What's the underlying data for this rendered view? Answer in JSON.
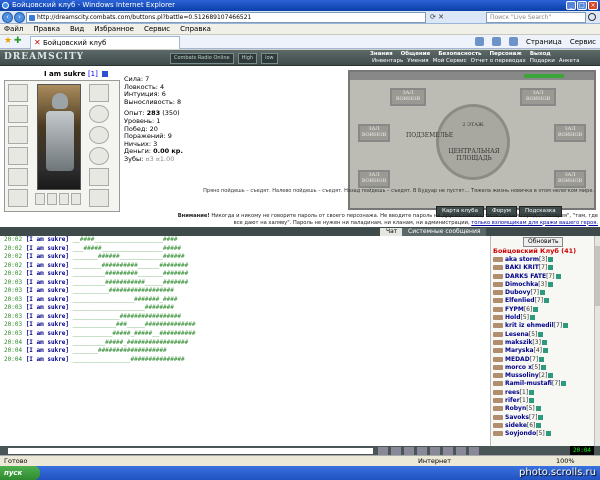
{
  "window": {
    "title": "Бойцовский клуб - Windows Internet Explorer"
  },
  "address": {
    "url": "http://dreamscity.combats.com/buttons.pl?battle=0.512689107466521",
    "search_placeholder": "Поиск \"Live Search\""
  },
  "menu": [
    "Файл",
    "Правка",
    "Вид",
    "Избранное",
    "Сервис",
    "Справка"
  ],
  "tab": {
    "label": "Бойцовский клуб"
  },
  "toolbar": {
    "page_label": "Страница",
    "tools_label": "Сервис"
  },
  "game": {
    "logo": "DREAMSCITY",
    "header_buttons": [
      "Combats Radio Online",
      "High",
      "low"
    ],
    "nav": [
      "Знания",
      "Общение",
      "Безопасность",
      "Персонаж",
      "Выход"
    ],
    "nav2": [
      "Инвентарь",
      "Умения",
      "Мой Сервис",
      "Отчет о переводах",
      "Подарки",
      "Анкета"
    ]
  },
  "player": {
    "name": "I am sukre",
    "level": "[1]"
  },
  "stats": {
    "strength": "Сила: 7",
    "agility": "Ловкость: 4",
    "intuition": "Интуиция: 6",
    "endurance": "Выносливость: 8",
    "exp_label": "Опыт:",
    "exp_value": "283",
    "exp_next": "(350)",
    "level": "Уровень: 1",
    "wins": "Побед: 20",
    "losses": "Поражений: 9",
    "draws": "Ничьих: 3",
    "money_label": "Деньги:",
    "money_value": "0.00 кр.",
    "teeth_label": "Зубы:",
    "teeth_value": "¤3 ¤1.00"
  },
  "map": {
    "floor": "2 ЭТАЖ",
    "center": "ЦЕНТРАЛЬНАЯ ПЛОЩАДЬ",
    "basement": "ПОДЗЕМЕЛЬЕ",
    "rooms": [
      "ЗАЛ ВОИНОВ",
      "ЗАЛ ВОИНОВ",
      "ЗАЛ ВОИНОВ",
      "ЗАЛ ВОИНОВ",
      "ЗАЛ ВОИНОВ",
      "ЗАЛ ВОИНОВ"
    ]
  },
  "quote": "Пряно пойдешь – съедят. Налево пойдешь – съедят. Назад пойдешь – съедят. В Будуар не пустят… Тяжела жизнь новичка в этом нелегком мире.",
  "buttons": {
    "map": "Карта клуба",
    "forum": "Форум",
    "hint": "Подсказка"
  },
  "warning": {
    "prefix": "Внимание!",
    "text": "Никогда и никому не говорите пароль от своего персонажа. Не вводите пароль на других сайтах, типа \"новый город\", \"лотерея\", \"там, где все дают на халяву\". Пароль не нужен ни паладинам, ни кланам, ни администрации,",
    "link": "только взломщикам для кражи вашего героя."
  },
  "chat_tabs": [
    "Чат",
    "Системные сообщения"
  ],
  "chat": [
    {
      "time": "20:02",
      "name": "[I am sukre]",
      "msg": "__####___________________####"
    },
    {
      "time": "20:02",
      "name": "[I am sukre]",
      "msg": "___#####_________________#####"
    },
    {
      "time": "20:02",
      "name": "[I am sukre]",
      "msg": "_______######____________######"
    },
    {
      "time": "20:02",
      "name": "[I am sukre]",
      "msg": "________##########______########"
    },
    {
      "time": "20:02",
      "name": "[I am sukre]",
      "msg": "_________#########_______#######"
    },
    {
      "time": "20:03",
      "name": "[I am sukre]",
      "msg": "_________###########_____#######"
    },
    {
      "time": "20:03",
      "name": "[I am sukre]",
      "msg": "__________##################"
    },
    {
      "time": "20:03",
      "name": "[I am sukre]",
      "msg": "_________________#######_####"
    },
    {
      "time": "20:03",
      "name": "[I am sukre]",
      "msg": "____________________########"
    },
    {
      "time": "20:03",
      "name": "[I am sukre]",
      "msg": "_____________#################"
    },
    {
      "time": "20:03",
      "name": "[I am sukre]",
      "msg": "____________###_____##############"
    },
    {
      "time": "20:03",
      "name": "[I am sukre]",
      "msg": "___________#####_#####__##########"
    },
    {
      "time": "20:04",
      "name": "[I am sukre]",
      "msg": "_________#####_#################"
    },
    {
      "time": "20:04",
      "name": "[I am sukre]",
      "msg": "_______###################"
    },
    {
      "time": "20:04",
      "name": "[I am sukre]",
      "msg": "________________###############"
    }
  ],
  "room": {
    "refresh": "Обновить",
    "title": "Бойцовский Клуб (41)"
  },
  "users": [
    {
      "name": "aka storm",
      "level": "[3]"
    },
    {
      "name": "BAKI KRIT",
      "level": "[7]"
    },
    {
      "name": "DARKS FATE",
      "level": "[7]"
    },
    {
      "name": "Dimochka",
      "level": "[3]"
    },
    {
      "name": "Dubovy",
      "level": "[7]"
    },
    {
      "name": "Elfenlied",
      "level": "[7]"
    },
    {
      "name": "FYPM",
      "level": "[6]"
    },
    {
      "name": "Hold",
      "level": "[5]"
    },
    {
      "name": "krit iz ehmedil",
      "level": "[7]"
    },
    {
      "name": "Lesena",
      "level": "[5]"
    },
    {
      "name": "makszik",
      "level": "[3]"
    },
    {
      "name": "Maryska",
      "level": "[4]"
    },
    {
      "name": "MEDAD",
      "level": "[7]"
    },
    {
      "name": "morco x",
      "level": "[5]"
    },
    {
      "name": "Mussoliny",
      "level": "[2]"
    },
    {
      "name": "Ramil-mustafi",
      "level": "[7]"
    },
    {
      "name": "rees",
      "level": "[1]"
    },
    {
      "name": "rifer",
      "level": "[1]"
    },
    {
      "name": "Robyn",
      "level": "[5]"
    },
    {
      "name": "Savoks",
      "level": "[7]"
    },
    {
      "name": "sideke",
      "level": "[6]"
    },
    {
      "name": "Soyjondo",
      "level": "[5]"
    }
  ],
  "clock": "20:04",
  "status": {
    "done": "Готово",
    "zone": "Интернет",
    "zoom": "100%"
  },
  "taskbar": {
    "start": "пуск"
  },
  "watermark": "photo.scrolls.ru",
  "colors": {
    "accent": "#2b63d6",
    "game_header": "#3f4a4a",
    "chat_time": "#2a8a2a",
    "user_name": "#00008b",
    "room_title": "#cc0000"
  }
}
